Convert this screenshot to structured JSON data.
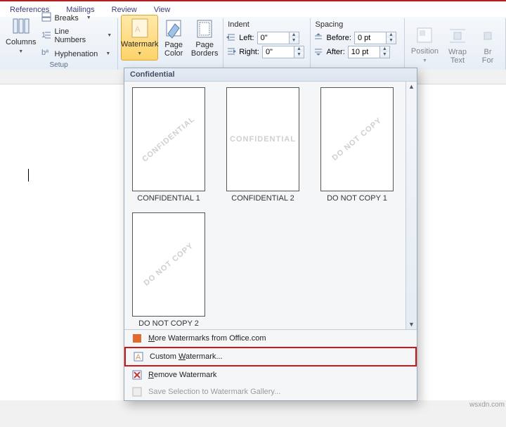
{
  "tabs": {
    "references": "References",
    "mailings": "Mailings",
    "review": "Review",
    "view": "View"
  },
  "ribbon": {
    "setup_label": "Setup",
    "columns": "Columns",
    "breaks": "Breaks",
    "line_numbers": "Line Numbers",
    "hyphenation": "Hyphenation",
    "watermark": "Watermark",
    "page_color": "Page\nColor",
    "page_borders": "Page\nBorders",
    "indent": {
      "title": "Indent",
      "left_lbl": "Left:",
      "right_lbl": "Right:",
      "left_val": "0\"",
      "right_val": "0\""
    },
    "spacing": {
      "title": "Spacing",
      "before_lbl": "Before:",
      "after_lbl": "After:",
      "before_val": "0 pt",
      "after_val": "10 pt"
    },
    "position": "Position",
    "wrap_text": "Wrap\nText",
    "bring_forward": "Br\nFor"
  },
  "gallery": {
    "category": "Confidential",
    "thumbs": [
      {
        "wm": "CONFIDENTIAL",
        "label": "CONFIDENTIAL 1",
        "fs": "11px"
      },
      {
        "wm": "CONFIDENTIAL",
        "label": "CONFIDENTIAL 2",
        "fs": "11px"
      },
      {
        "wm": "DO NOT COPY",
        "label": "DO NOT COPY 1",
        "fs": "11px"
      },
      {
        "wm": "DO NOT COPY",
        "label": "DO NOT COPY 2",
        "fs": "11px"
      }
    ],
    "more": "More Watermarks from Office.com",
    "custom": "Custom Watermark...",
    "remove": "Remove Watermark",
    "save_sel": "Save Selection to Watermark Gallery..."
  },
  "attrib": "wsxdn.com"
}
